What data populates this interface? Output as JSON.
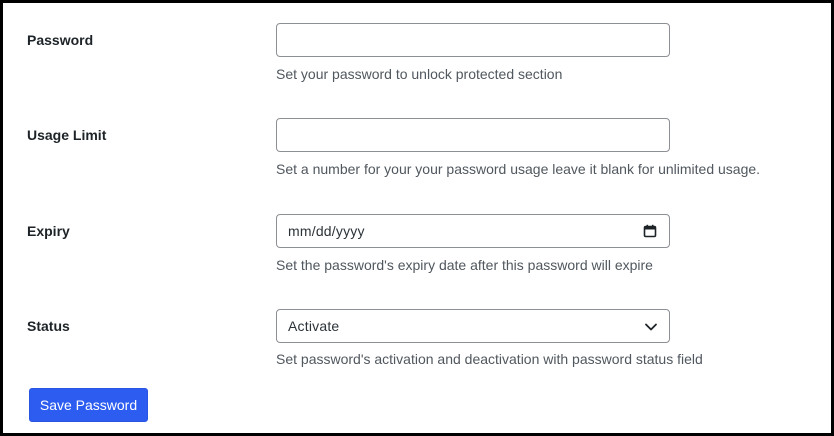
{
  "form": {
    "password": {
      "label": "Password",
      "value": "",
      "help": "Set your password to unlock protected section"
    },
    "usage_limit": {
      "label": "Usage Limit",
      "value": "",
      "help": "Set a number for your your password usage leave it blank for unlimited usage."
    },
    "expiry": {
      "label": "Expiry",
      "placeholder": "mm/dd/yyyy",
      "icon": "calendar-icon",
      "help": "Set the password's expiry date after this password will expire"
    },
    "status": {
      "label": "Status",
      "selected": "Activate",
      "icon": "chevron-down-icon",
      "help": "Set password's activation and deactivation with password status field"
    }
  },
  "actions": {
    "save_label": "Save Password",
    "save_color": "#2c5cf0"
  }
}
